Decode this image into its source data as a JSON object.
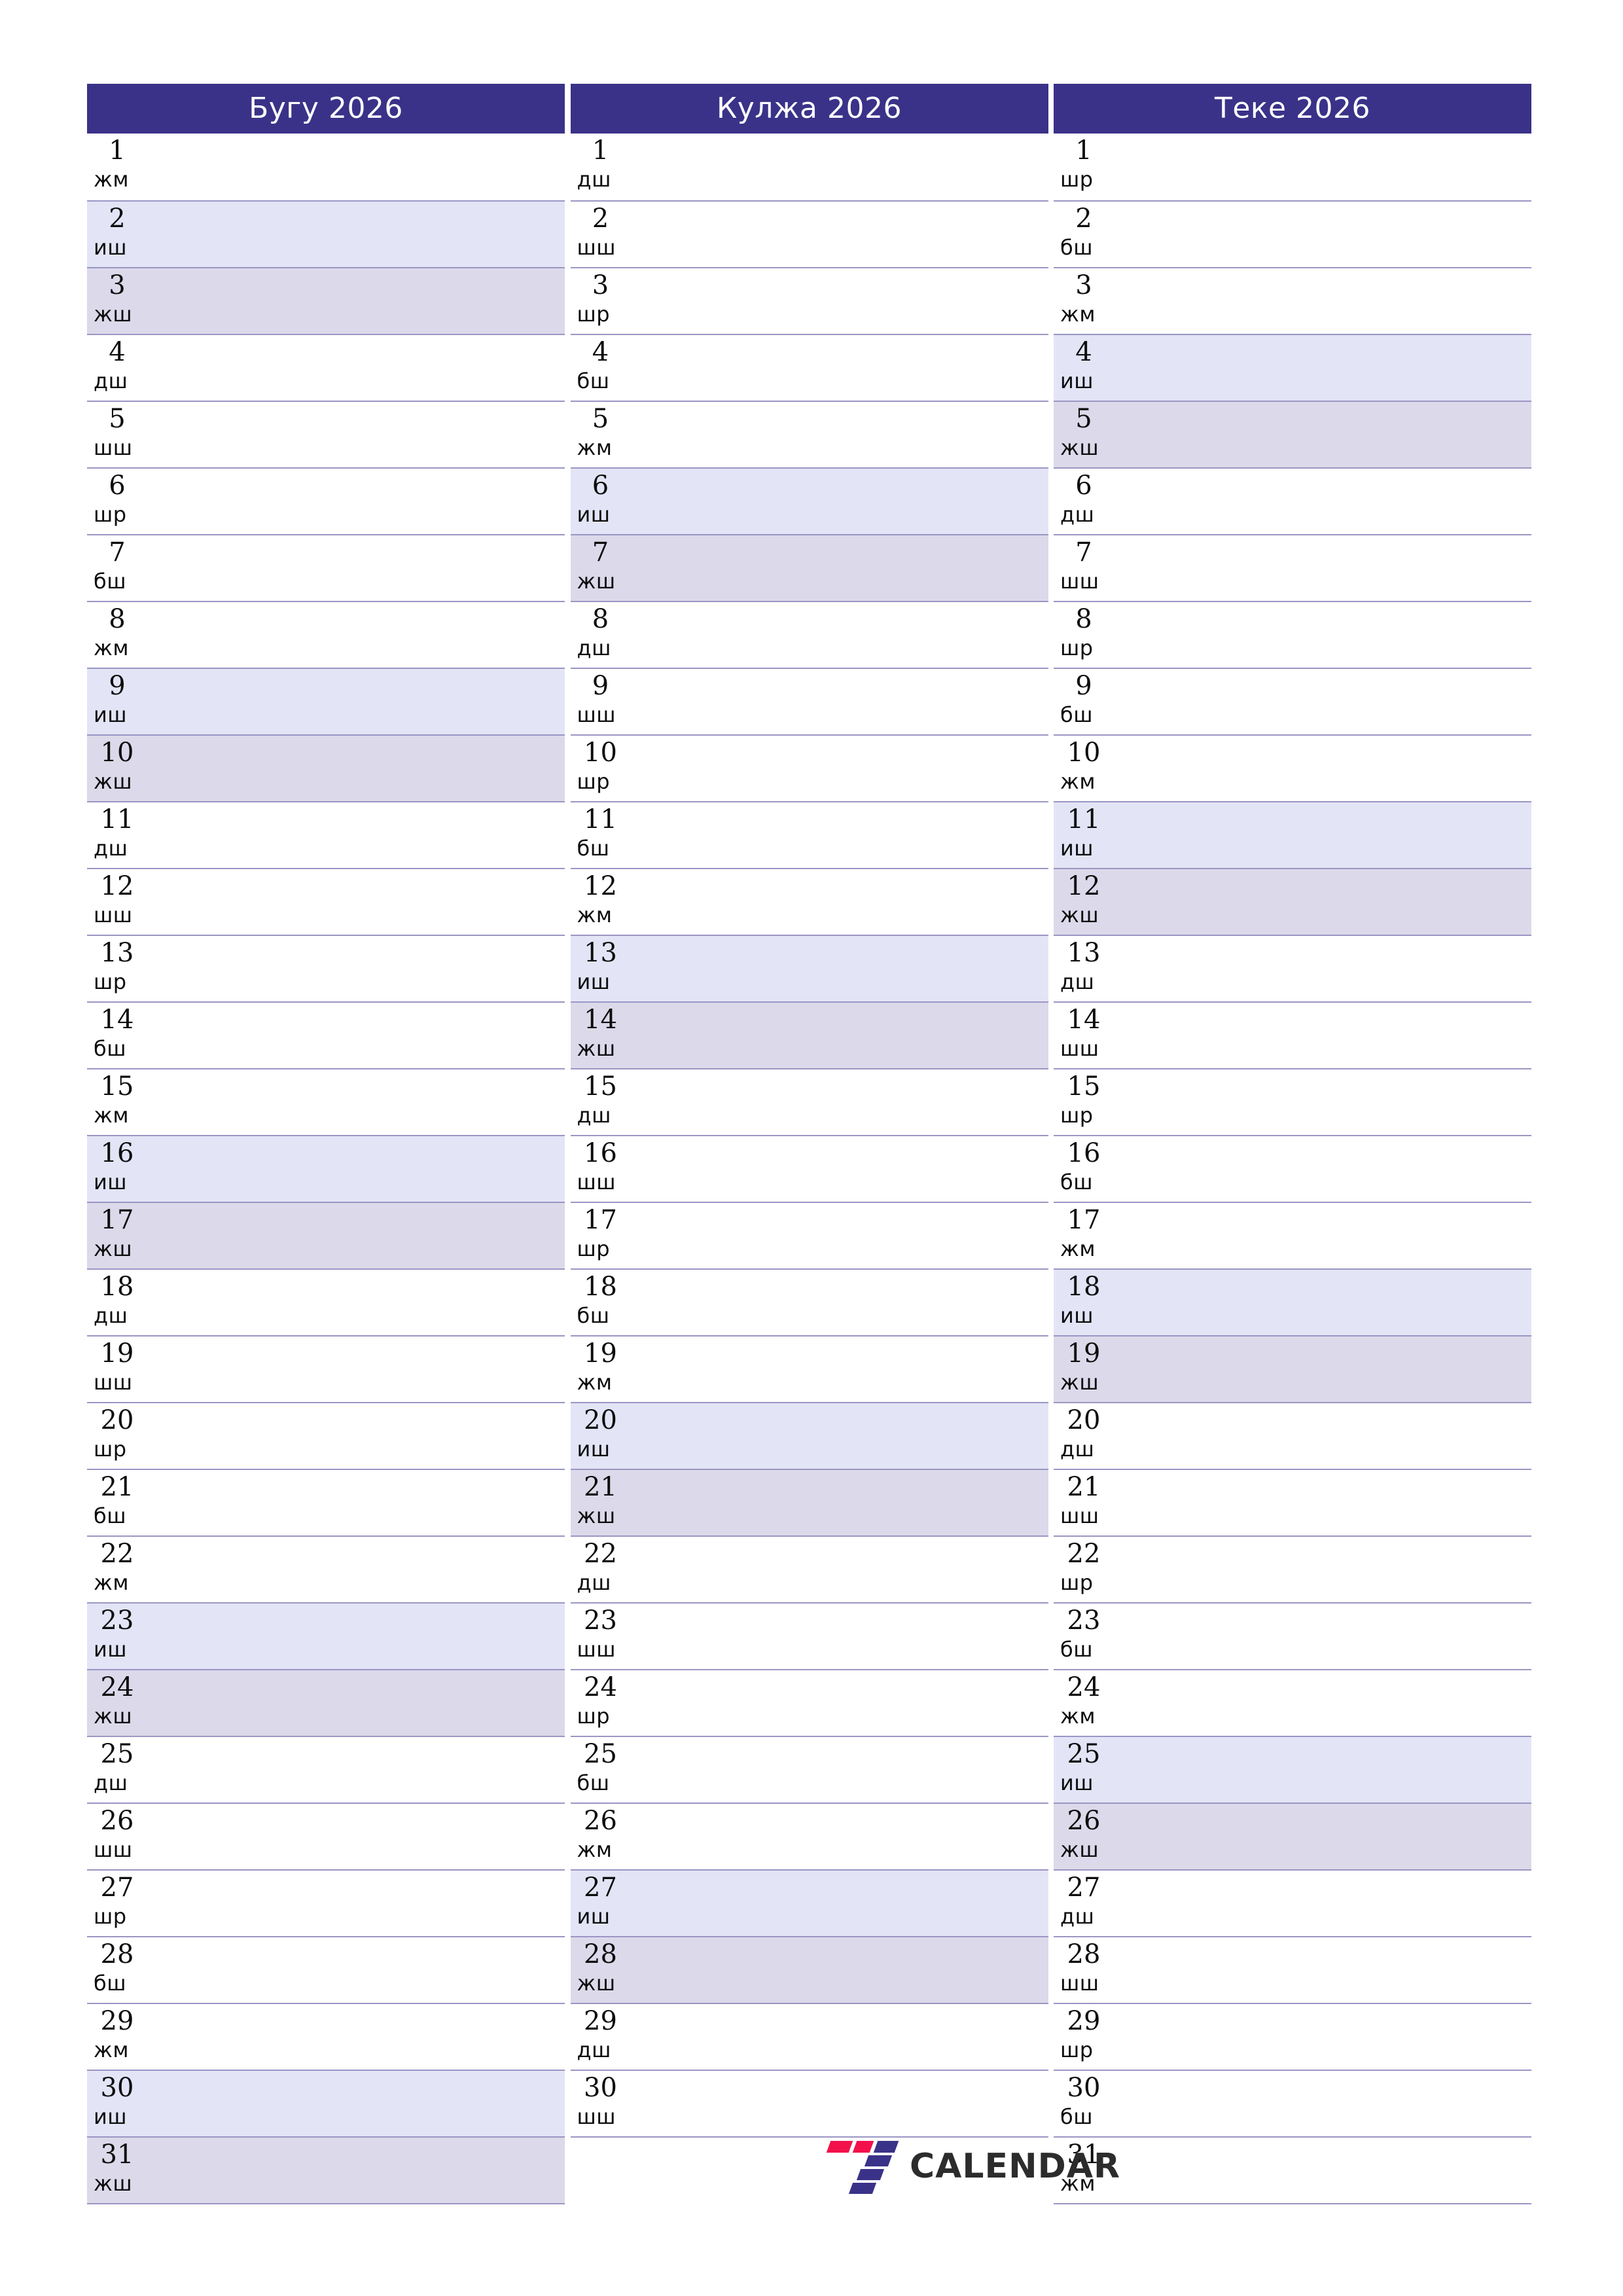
{
  "document": {
    "type": "printable-monthly-planner",
    "year": "2026",
    "orientation": "portrait"
  },
  "colors": {
    "header_bg": "#3a3288",
    "header_text": "#ffffff",
    "saturday_bg": "#e3e4f6",
    "sunday_bg": "#dcd9ea",
    "grid_line": "#9a96c4",
    "logo_red": "#f3114b",
    "logo_blue": "#3a3288",
    "logo_word": "#2c2c2c"
  },
  "weekday_abbr": {
    "monday": "дш",
    "tuesday": "шш",
    "wednesday": "шр",
    "thursday": "бш",
    "friday": "жм",
    "saturday": "иш",
    "sunday": "жш"
  },
  "footer": {
    "logo_mark": "seven-slabs-logo",
    "logo_word": "CALENDAR"
  },
  "months": [
    {
      "title": "Бугу 2026",
      "name": "Бугу",
      "year": "2026",
      "days": [
        {
          "n": "1",
          "wd": "жм",
          "t": "weekday"
        },
        {
          "n": "2",
          "wd": "иш",
          "t": "sat"
        },
        {
          "n": "3",
          "wd": "жш",
          "t": "sun"
        },
        {
          "n": "4",
          "wd": "дш",
          "t": "weekday"
        },
        {
          "n": "5",
          "wd": "шш",
          "t": "weekday"
        },
        {
          "n": "6",
          "wd": "шр",
          "t": "weekday"
        },
        {
          "n": "7",
          "wd": "бш",
          "t": "weekday"
        },
        {
          "n": "8",
          "wd": "жм",
          "t": "weekday"
        },
        {
          "n": "9",
          "wd": "иш",
          "t": "sat"
        },
        {
          "n": "10",
          "wd": "жш",
          "t": "sun"
        },
        {
          "n": "11",
          "wd": "дш",
          "t": "weekday"
        },
        {
          "n": "12",
          "wd": "шш",
          "t": "weekday"
        },
        {
          "n": "13",
          "wd": "шр",
          "t": "weekday"
        },
        {
          "n": "14",
          "wd": "бш",
          "t": "weekday"
        },
        {
          "n": "15",
          "wd": "жм",
          "t": "weekday"
        },
        {
          "n": "16",
          "wd": "иш",
          "t": "sat"
        },
        {
          "n": "17",
          "wd": "жш",
          "t": "sun"
        },
        {
          "n": "18",
          "wd": "дш",
          "t": "weekday"
        },
        {
          "n": "19",
          "wd": "шш",
          "t": "weekday"
        },
        {
          "n": "20",
          "wd": "шр",
          "t": "weekday"
        },
        {
          "n": "21",
          "wd": "бш",
          "t": "weekday"
        },
        {
          "n": "22",
          "wd": "жм",
          "t": "weekday"
        },
        {
          "n": "23",
          "wd": "иш",
          "t": "sat"
        },
        {
          "n": "24",
          "wd": "жш",
          "t": "sun"
        },
        {
          "n": "25",
          "wd": "дш",
          "t": "weekday"
        },
        {
          "n": "26",
          "wd": "шш",
          "t": "weekday"
        },
        {
          "n": "27",
          "wd": "шр",
          "t": "weekday"
        },
        {
          "n": "28",
          "wd": "бш",
          "t": "weekday"
        },
        {
          "n": "29",
          "wd": "жм",
          "t": "weekday"
        },
        {
          "n": "30",
          "wd": "иш",
          "t": "sat"
        },
        {
          "n": "31",
          "wd": "жш",
          "t": "sun"
        }
      ]
    },
    {
      "title": "Кулжа 2026",
      "name": "Кулжа",
      "year": "2026",
      "days": [
        {
          "n": "1",
          "wd": "дш",
          "t": "weekday"
        },
        {
          "n": "2",
          "wd": "шш",
          "t": "weekday"
        },
        {
          "n": "3",
          "wd": "шр",
          "t": "weekday"
        },
        {
          "n": "4",
          "wd": "бш",
          "t": "weekday"
        },
        {
          "n": "5",
          "wd": "жм",
          "t": "weekday"
        },
        {
          "n": "6",
          "wd": "иш",
          "t": "sat"
        },
        {
          "n": "7",
          "wd": "жш",
          "t": "sun"
        },
        {
          "n": "8",
          "wd": "дш",
          "t": "weekday"
        },
        {
          "n": "9",
          "wd": "шш",
          "t": "weekday"
        },
        {
          "n": "10",
          "wd": "шр",
          "t": "weekday"
        },
        {
          "n": "11",
          "wd": "бш",
          "t": "weekday"
        },
        {
          "n": "12",
          "wd": "жм",
          "t": "weekday"
        },
        {
          "n": "13",
          "wd": "иш",
          "t": "sat"
        },
        {
          "n": "14",
          "wd": "жш",
          "t": "sun"
        },
        {
          "n": "15",
          "wd": "дш",
          "t": "weekday"
        },
        {
          "n": "16",
          "wd": "шш",
          "t": "weekday"
        },
        {
          "n": "17",
          "wd": "шр",
          "t": "weekday"
        },
        {
          "n": "18",
          "wd": "бш",
          "t": "weekday"
        },
        {
          "n": "19",
          "wd": "жм",
          "t": "weekday"
        },
        {
          "n": "20",
          "wd": "иш",
          "t": "sat"
        },
        {
          "n": "21",
          "wd": "жш",
          "t": "sun"
        },
        {
          "n": "22",
          "wd": "дш",
          "t": "weekday"
        },
        {
          "n": "23",
          "wd": "шш",
          "t": "weekday"
        },
        {
          "n": "24",
          "wd": "шр",
          "t": "weekday"
        },
        {
          "n": "25",
          "wd": "бш",
          "t": "weekday"
        },
        {
          "n": "26",
          "wd": "жм",
          "t": "weekday"
        },
        {
          "n": "27",
          "wd": "иш",
          "t": "sat"
        },
        {
          "n": "28",
          "wd": "жш",
          "t": "sun"
        },
        {
          "n": "29",
          "wd": "дш",
          "t": "weekday"
        },
        {
          "n": "30",
          "wd": "шш",
          "t": "weekday"
        }
      ]
    },
    {
      "title": "Теке 2026",
      "name": "Теке",
      "year": "2026",
      "days": [
        {
          "n": "1",
          "wd": "шр",
          "t": "weekday"
        },
        {
          "n": "2",
          "wd": "бш",
          "t": "weekday"
        },
        {
          "n": "3",
          "wd": "жм",
          "t": "weekday"
        },
        {
          "n": "4",
          "wd": "иш",
          "t": "sat"
        },
        {
          "n": "5",
          "wd": "жш",
          "t": "sun"
        },
        {
          "n": "6",
          "wd": "дш",
          "t": "weekday"
        },
        {
          "n": "7",
          "wd": "шш",
          "t": "weekday"
        },
        {
          "n": "8",
          "wd": "шр",
          "t": "weekday"
        },
        {
          "n": "9",
          "wd": "бш",
          "t": "weekday"
        },
        {
          "n": "10",
          "wd": "жм",
          "t": "weekday"
        },
        {
          "n": "11",
          "wd": "иш",
          "t": "sat"
        },
        {
          "n": "12",
          "wd": "жш",
          "t": "sun"
        },
        {
          "n": "13",
          "wd": "дш",
          "t": "weekday"
        },
        {
          "n": "14",
          "wd": "шш",
          "t": "weekday"
        },
        {
          "n": "15",
          "wd": "шр",
          "t": "weekday"
        },
        {
          "n": "16",
          "wd": "бш",
          "t": "weekday"
        },
        {
          "n": "17",
          "wd": "жм",
          "t": "weekday"
        },
        {
          "n": "18",
          "wd": "иш",
          "t": "sat"
        },
        {
          "n": "19",
          "wd": "жш",
          "t": "sun"
        },
        {
          "n": "20",
          "wd": "дш",
          "t": "weekday"
        },
        {
          "n": "21",
          "wd": "шш",
          "t": "weekday"
        },
        {
          "n": "22",
          "wd": "шр",
          "t": "weekday"
        },
        {
          "n": "23",
          "wd": "бш",
          "t": "weekday"
        },
        {
          "n": "24",
          "wd": "жм",
          "t": "weekday"
        },
        {
          "n": "25",
          "wd": "иш",
          "t": "sat"
        },
        {
          "n": "26",
          "wd": "жш",
          "t": "sun"
        },
        {
          "n": "27",
          "wd": "дш",
          "t": "weekday"
        },
        {
          "n": "28",
          "wd": "шш",
          "t": "weekday"
        },
        {
          "n": "29",
          "wd": "шр",
          "t": "weekday"
        },
        {
          "n": "30",
          "wd": "бш",
          "t": "weekday"
        },
        {
          "n": "31",
          "wd": "жм",
          "t": "weekday"
        }
      ]
    }
  ]
}
